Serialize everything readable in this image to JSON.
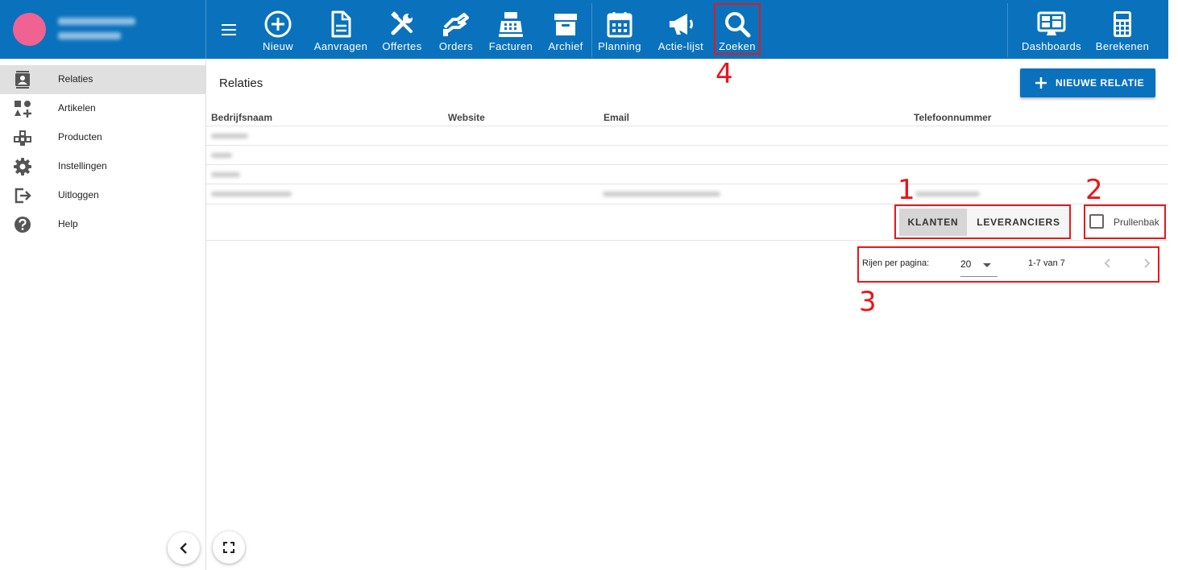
{
  "nav": [
    {
      "id": "nieuw",
      "label": "Nieuw",
      "icon": "plus-circle-icon"
    },
    {
      "id": "aanvragen",
      "label": "Aanvragen",
      "icon": "document-icon"
    },
    {
      "id": "offertes",
      "label": "Offertes",
      "icon": "tools-icon"
    },
    {
      "id": "orders",
      "label": "Orders",
      "icon": "handshake-icon"
    },
    {
      "id": "facturen",
      "label": "Facturen",
      "icon": "cash-register-icon"
    },
    {
      "id": "archief",
      "label": "Archief",
      "icon": "archive-box-icon"
    },
    {
      "id": "planning",
      "label": "Planning",
      "icon": "calendar-icon"
    },
    {
      "id": "actie-lijst",
      "label": "Actie-lijst",
      "icon": "megaphone-icon"
    },
    {
      "id": "zoeken",
      "label": "Zoeken",
      "icon": "search-icon"
    },
    {
      "id": "dashboards",
      "label": "Dashboards",
      "icon": "dashboard-monitor-icon"
    },
    {
      "id": "berekenen",
      "label": "Berekenen",
      "icon": "calculator-icon"
    }
  ],
  "sidebar": {
    "items": [
      {
        "label": "Relaties",
        "icon": "contacts-icon"
      },
      {
        "label": "Artikelen",
        "icon": "shapes-icon"
      },
      {
        "label": "Producten",
        "icon": "blocks-icon"
      },
      {
        "label": "Instellingen",
        "icon": "gear-icon"
      },
      {
        "label": "Uitloggen",
        "icon": "logout-icon"
      },
      {
        "label": "Help",
        "icon": "help-icon"
      }
    ],
    "active": "Relaties"
  },
  "main": {
    "title": "Relaties",
    "new_button": "NIEUWE RELATIE"
  },
  "table": {
    "columns": [
      "Bedrijfsnaam",
      "Website",
      "Email",
      "Telefoonnummer"
    ]
  },
  "filters": {
    "segments": [
      "KLANTEN",
      "LEVERANCIERS"
    ],
    "selected": "KLANTEN",
    "trash_label": "Prullenbak",
    "trash_checked": false
  },
  "pagination": {
    "rows_label": "Rijen per pagina:",
    "rows_value": "20",
    "range": "1-7 van 7"
  },
  "annotations": [
    "1",
    "2",
    "3",
    "4"
  ],
  "colors": {
    "primary": "#0a72bc",
    "annotation": "#e8161c",
    "avatar": "#f06292"
  }
}
